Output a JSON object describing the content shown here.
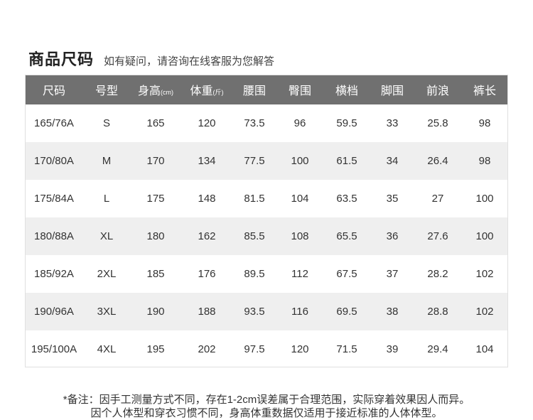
{
  "header": {
    "title": "商品尺码",
    "subtitle": "如有疑问，请咨询在线客服为您解答"
  },
  "table": {
    "columns": [
      {
        "label": "尺码",
        "unit": ""
      },
      {
        "label": "号型",
        "unit": ""
      },
      {
        "label": "身高",
        "unit": "(cm)"
      },
      {
        "label": "体重",
        "unit": "(斤)"
      },
      {
        "label": "腰围",
        "unit": ""
      },
      {
        "label": "臀围",
        "unit": ""
      },
      {
        "label": "横档",
        "unit": ""
      },
      {
        "label": "脚围",
        "unit": ""
      },
      {
        "label": "前浪",
        "unit": ""
      },
      {
        "label": "裤长",
        "unit": ""
      }
    ],
    "rows": [
      [
        "165/76A",
        "S",
        "165",
        "120",
        "73.5",
        "96",
        "59.5",
        "33",
        "25.8",
        "98"
      ],
      [
        "170/80A",
        "M",
        "170",
        "134",
        "77.5",
        "100",
        "61.5",
        "34",
        "26.4",
        "98"
      ],
      [
        "175/84A",
        "L",
        "175",
        "148",
        "81.5",
        "104",
        "63.5",
        "35",
        "27",
        "100"
      ],
      [
        "180/88A",
        "XL",
        "180",
        "162",
        "85.5",
        "108",
        "65.5",
        "36",
        "27.6",
        "100"
      ],
      [
        "185/92A",
        "2XL",
        "185",
        "176",
        "89.5",
        "112",
        "67.5",
        "37",
        "28.2",
        "102"
      ],
      [
        "190/96A",
        "3XL",
        "190",
        "188",
        "93.5",
        "116",
        "69.5",
        "38",
        "28.8",
        "102"
      ],
      [
        "195/100A",
        "4XL",
        "195",
        "202",
        "97.5",
        "120",
        "71.5",
        "39",
        "29.4",
        "104"
      ]
    ]
  },
  "notes": {
    "line1": "*备注：因手工测量方式不同，存在1-2cm误差属于合理范围，实际穿着效果因人而异。",
    "line2": "因个人体型和穿衣习惯不同，身高体重数据仅适用于接近标准的人体体型。"
  }
}
